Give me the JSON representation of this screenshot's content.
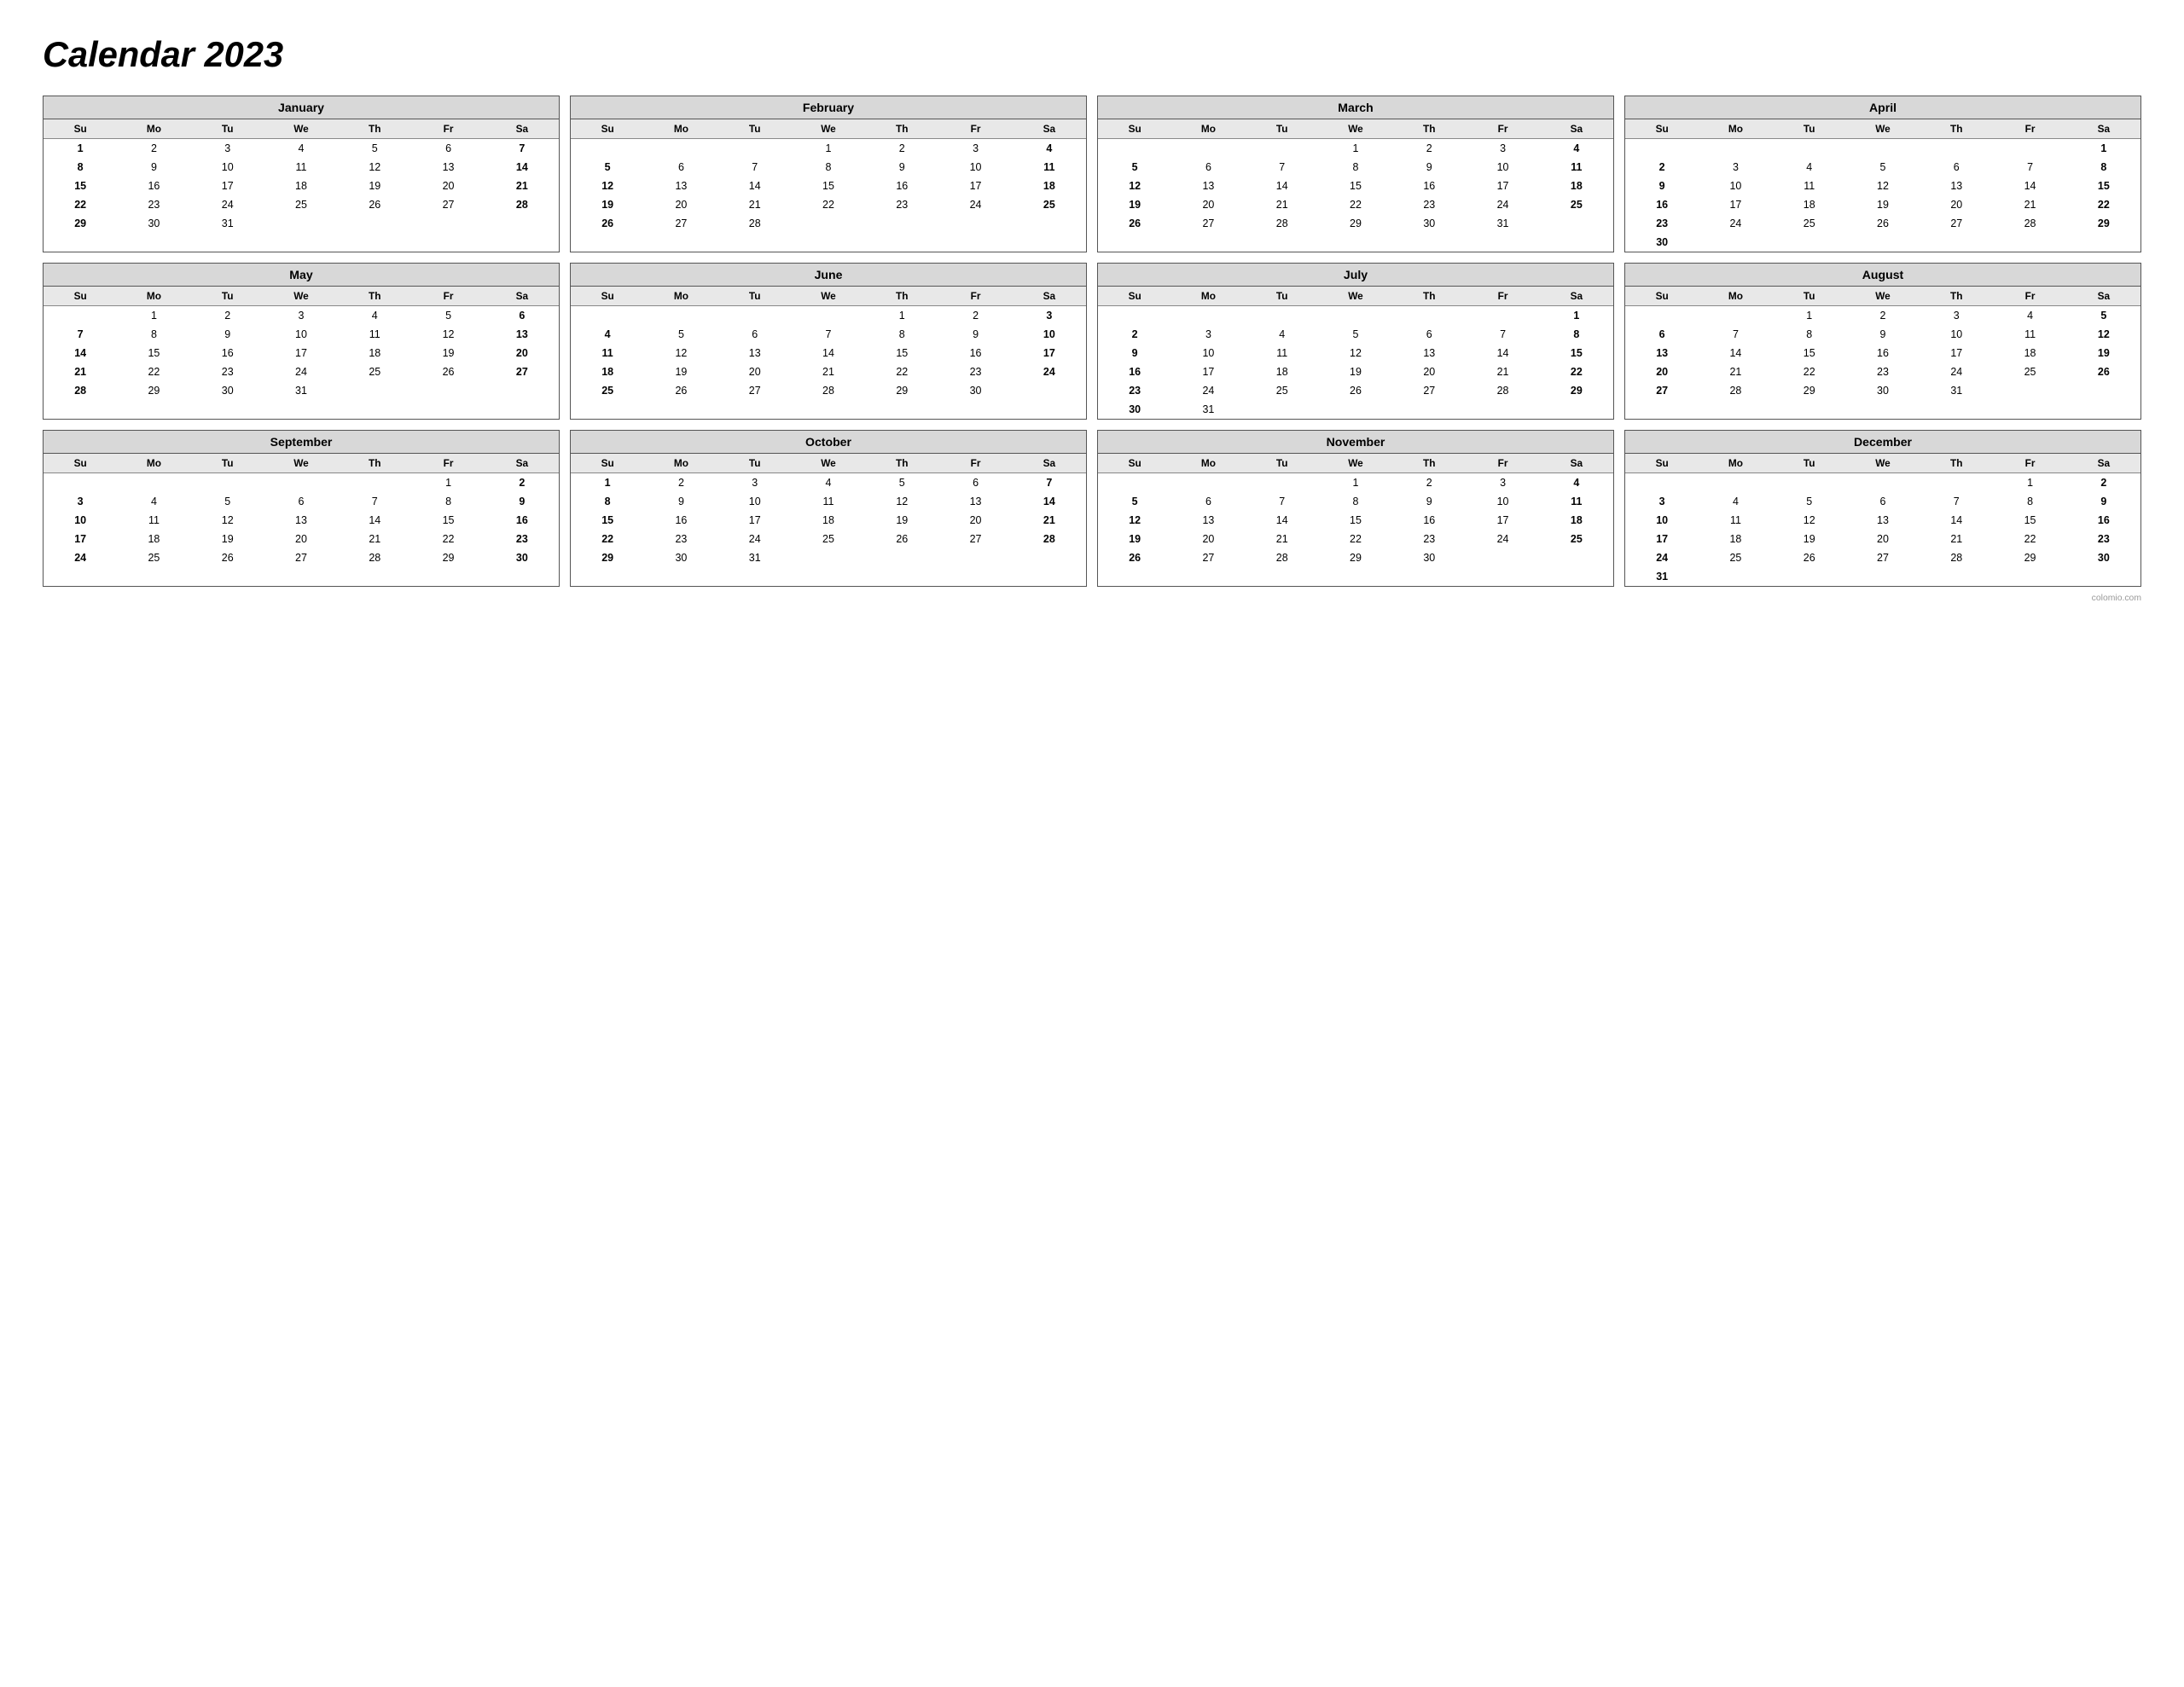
{
  "title": "Calendar 2023",
  "months": [
    {
      "name": "January",
      "headers": [
        "Su",
        "Mo",
        "Tu",
        "We",
        "Th",
        "Fr",
        "Sa"
      ],
      "weeks": [
        [
          "",
          "",
          "",
          "",
          "",
          "",
          ""
        ],
        [
          "1",
          "2",
          "3",
          "4",
          "5",
          "6",
          "7"
        ],
        [
          "8",
          "9",
          "10",
          "11",
          "12",
          "13",
          "14"
        ],
        [
          "15",
          "16",
          "17",
          "18",
          "19",
          "20",
          "21"
        ],
        [
          "22",
          "23",
          "24",
          "25",
          "26",
          "27",
          "28"
        ],
        [
          "29",
          "30",
          "31",
          "",
          "",
          "",
          ""
        ]
      ]
    },
    {
      "name": "February",
      "headers": [
        "Su",
        "Mo",
        "Tu",
        "We",
        "Th",
        "Fr",
        "Sa"
      ],
      "weeks": [
        [
          "",
          "",
          "",
          "1",
          "2",
          "3",
          "4"
        ],
        [
          "5",
          "6",
          "7",
          "8",
          "9",
          "10",
          "11"
        ],
        [
          "12",
          "13",
          "14",
          "15",
          "16",
          "17",
          "18"
        ],
        [
          "19",
          "20",
          "21",
          "22",
          "23",
          "24",
          "25"
        ],
        [
          "26",
          "27",
          "28",
          "",
          "",
          "",
          ""
        ],
        [
          "",
          "",
          "",
          "",
          "",
          "",
          ""
        ]
      ]
    },
    {
      "name": "March",
      "headers": [
        "Su",
        "Mo",
        "Tu",
        "We",
        "Th",
        "Fr",
        "Sa"
      ],
      "weeks": [
        [
          "",
          "",
          "",
          "1",
          "2",
          "3",
          "4"
        ],
        [
          "5",
          "6",
          "7",
          "8",
          "9",
          "10",
          "11"
        ],
        [
          "12",
          "13",
          "14",
          "15",
          "16",
          "17",
          "18"
        ],
        [
          "19",
          "20",
          "21",
          "22",
          "23",
          "24",
          "25"
        ],
        [
          "26",
          "27",
          "28",
          "29",
          "30",
          "31",
          ""
        ],
        [
          "",
          "",
          "",
          "",
          "",
          "",
          ""
        ]
      ]
    },
    {
      "name": "April",
      "headers": [
        "Su",
        "Mo",
        "Tu",
        "We",
        "Th",
        "Fr",
        "Sa"
      ],
      "weeks": [
        [
          "",
          "",
          "",
          "",
          "",
          "",
          "1"
        ],
        [
          "2",
          "3",
          "4",
          "5",
          "6",
          "7",
          "8"
        ],
        [
          "9",
          "10",
          "11",
          "12",
          "13",
          "14",
          "15"
        ],
        [
          "16",
          "17",
          "18",
          "19",
          "20",
          "21",
          "22"
        ],
        [
          "23",
          "24",
          "25",
          "26",
          "27",
          "28",
          "29"
        ],
        [
          "30",
          "",
          "",
          "",
          "",
          "",
          ""
        ]
      ]
    },
    {
      "name": "May",
      "headers": [
        "Su",
        "Mo",
        "Tu",
        "We",
        "Th",
        "Fr",
        "Sa"
      ],
      "weeks": [
        [
          "",
          "1",
          "2",
          "3",
          "4",
          "5",
          "6"
        ],
        [
          "7",
          "8",
          "9",
          "10",
          "11",
          "12",
          "13"
        ],
        [
          "14",
          "15",
          "16",
          "17",
          "18",
          "19",
          "20"
        ],
        [
          "21",
          "22",
          "23",
          "24",
          "25",
          "26",
          "27"
        ],
        [
          "28",
          "29",
          "30",
          "31",
          "",
          "",
          ""
        ],
        [
          "",
          "",
          "",
          "",
          "",
          "",
          ""
        ]
      ]
    },
    {
      "name": "June",
      "headers": [
        "Su",
        "Mo",
        "Tu",
        "We",
        "Th",
        "Fr",
        "Sa"
      ],
      "weeks": [
        [
          "",
          "",
          "",
          "",
          "1",
          "2",
          "3"
        ],
        [
          "4",
          "5",
          "6",
          "7",
          "8",
          "9",
          "10"
        ],
        [
          "11",
          "12",
          "13",
          "14",
          "15",
          "16",
          "17"
        ],
        [
          "18",
          "19",
          "20",
          "21",
          "22",
          "23",
          "24"
        ],
        [
          "25",
          "26",
          "27",
          "28",
          "29",
          "30",
          ""
        ],
        [
          "",
          "",
          "",
          "",
          "",
          "",
          ""
        ]
      ]
    },
    {
      "name": "July",
      "headers": [
        "Su",
        "Mo",
        "Tu",
        "We",
        "Th",
        "Fr",
        "Sa"
      ],
      "weeks": [
        [
          "",
          "",
          "",
          "",
          "",
          "",
          "1"
        ],
        [
          "2",
          "3",
          "4",
          "5",
          "6",
          "7",
          "8"
        ],
        [
          "9",
          "10",
          "11",
          "12",
          "13",
          "14",
          "15"
        ],
        [
          "16",
          "17",
          "18",
          "19",
          "20",
          "21",
          "22"
        ],
        [
          "23",
          "24",
          "25",
          "26",
          "27",
          "28",
          "29"
        ],
        [
          "30",
          "31",
          "",
          "",
          "",
          "",
          ""
        ]
      ]
    },
    {
      "name": "August",
      "headers": [
        "Su",
        "Mo",
        "Tu",
        "We",
        "Th",
        "Fr",
        "Sa"
      ],
      "weeks": [
        [
          "",
          "",
          "1",
          "2",
          "3",
          "4",
          "5"
        ],
        [
          "6",
          "7",
          "8",
          "9",
          "10",
          "11",
          "12"
        ],
        [
          "13",
          "14",
          "15",
          "16",
          "17",
          "18",
          "19"
        ],
        [
          "20",
          "21",
          "22",
          "23",
          "24",
          "25",
          "26"
        ],
        [
          "27",
          "28",
          "29",
          "30",
          "31",
          "",
          ""
        ],
        [
          "",
          "",
          "",
          "",
          "",
          "",
          ""
        ]
      ]
    },
    {
      "name": "September",
      "headers": [
        "Su",
        "Mo",
        "Tu",
        "We",
        "Th",
        "Fr",
        "Sa"
      ],
      "weeks": [
        [
          "",
          "",
          "",
          "",
          "",
          "1",
          "2"
        ],
        [
          "3",
          "4",
          "5",
          "6",
          "7",
          "8",
          "9"
        ],
        [
          "10",
          "11",
          "12",
          "13",
          "14",
          "15",
          "16"
        ],
        [
          "17",
          "18",
          "19",
          "20",
          "21",
          "22",
          "23"
        ],
        [
          "24",
          "25",
          "26",
          "27",
          "28",
          "29",
          "30"
        ],
        [
          "",
          "",
          "",
          "",
          "",
          "",
          ""
        ]
      ]
    },
    {
      "name": "October",
      "headers": [
        "Su",
        "Mo",
        "Tu",
        "We",
        "Th",
        "Fr",
        "Sa"
      ],
      "weeks": [
        [
          "1",
          "2",
          "3",
          "4",
          "5",
          "6",
          "7"
        ],
        [
          "8",
          "9",
          "10",
          "11",
          "12",
          "13",
          "14"
        ],
        [
          "15",
          "16",
          "17",
          "18",
          "19",
          "20",
          "21"
        ],
        [
          "22",
          "23",
          "24",
          "25",
          "26",
          "27",
          "28"
        ],
        [
          "29",
          "30",
          "31",
          "",
          "",
          "",
          ""
        ],
        [
          "",
          "",
          "",
          "",
          "",
          "",
          ""
        ]
      ]
    },
    {
      "name": "November",
      "headers": [
        "Su",
        "Mo",
        "Tu",
        "We",
        "Th",
        "Fr",
        "Sa"
      ],
      "weeks": [
        [
          "",
          "",
          "",
          "1",
          "2",
          "3",
          "4"
        ],
        [
          "5",
          "6",
          "7",
          "8",
          "9",
          "10",
          "11"
        ],
        [
          "12",
          "13",
          "14",
          "15",
          "16",
          "17",
          "18"
        ],
        [
          "19",
          "20",
          "21",
          "22",
          "23",
          "24",
          "25"
        ],
        [
          "26",
          "27",
          "28",
          "29",
          "30",
          "",
          ""
        ],
        [
          "",
          "",
          "",
          "",
          "",
          "",
          ""
        ]
      ]
    },
    {
      "name": "December",
      "headers": [
        "Su",
        "Mo",
        "Tu",
        "We",
        "Th",
        "Fr",
        "Sa"
      ],
      "weeks": [
        [
          "",
          "",
          "",
          "",
          "",
          "1",
          "2"
        ],
        [
          "3",
          "4",
          "5",
          "6",
          "7",
          "8",
          "9"
        ],
        [
          "10",
          "11",
          "12",
          "13",
          "14",
          "15",
          "16"
        ],
        [
          "17",
          "18",
          "19",
          "20",
          "21",
          "22",
          "23"
        ],
        [
          "24",
          "25",
          "26",
          "27",
          "28",
          "29",
          "30"
        ],
        [
          "31",
          "",
          "",
          "",
          "",
          "",
          ""
        ]
      ]
    }
  ],
  "footer": "colomio.com"
}
